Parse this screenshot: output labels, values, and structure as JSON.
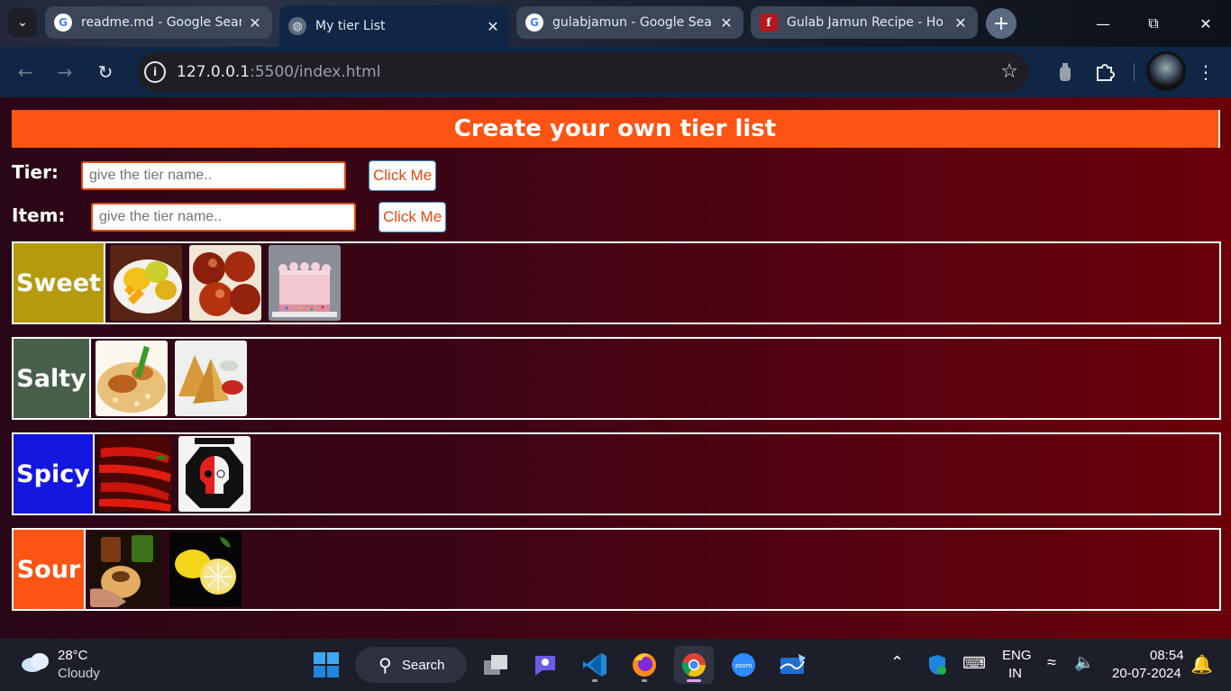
{
  "browser": {
    "tabs": [
      {
        "title": "readme.md - Google Sear",
        "favicon": "google-icon",
        "active": false
      },
      {
        "title": "My tier List",
        "favicon": "globe-icon",
        "active": true
      },
      {
        "title": "gulabjamun - Google Sea",
        "favicon": "google-icon",
        "active": false
      },
      {
        "title": "Gulab Jamun Recipe - Ho",
        "favicon": "f-icon",
        "active": false
      }
    ],
    "url_host": "127.0.0.1",
    "url_path": ":5500/index.html"
  },
  "page": {
    "header": "Create your own tier list",
    "tier_label": "Tier:",
    "tier_placeholder": "give the tier name..",
    "item_label": "Item:",
    "item_placeholder": "give the tier name..",
    "button_label": "Click Me",
    "tiers": [
      {
        "name": "Sweet",
        "color": "#b59a0e",
        "items": [
          "mango",
          "gulab jamun",
          "cake"
        ]
      },
      {
        "name": "Salty",
        "color": "#48604a",
        "items": [
          "biryani",
          "samosa"
        ]
      },
      {
        "name": "Spicy",
        "color": "#1317e0",
        "items": [
          "red chillies",
          "skull logo"
        ]
      },
      {
        "name": "Sour",
        "color": "#fe5413",
        "items": [
          "pani puri",
          "lemon"
        ]
      }
    ]
  },
  "taskbar": {
    "weather_temp": "28°C",
    "weather_desc": "Cloudy",
    "search_label": "Search",
    "lang_top": "ENG",
    "lang_bottom": "IN",
    "time": "08:54",
    "date": "20-07-2024"
  }
}
